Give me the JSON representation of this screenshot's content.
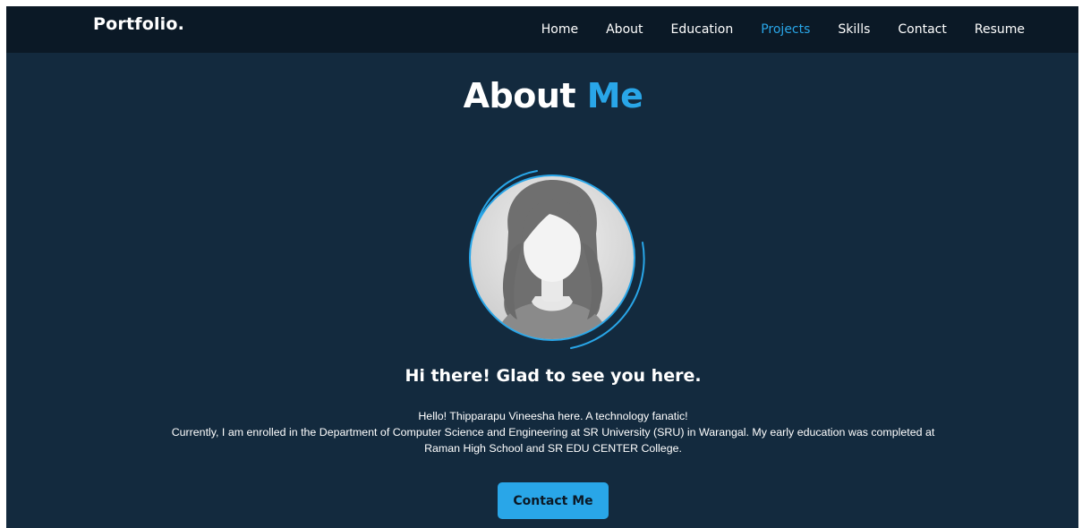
{
  "nav": {
    "brand": "Portfolio.",
    "links": [
      "Home",
      "About",
      "Education",
      "Projects",
      "Skills",
      "Contact",
      "Resume"
    ],
    "active": "Projects"
  },
  "about": {
    "title_part1": "About",
    "title_part2": "Me",
    "greeting": "Hi there! Glad to see you here.",
    "line1": "Hello! Thipparapu Vineesha here. A technology fanatic!",
    "line2": "Currently, I am enrolled in the Department of Computer Science and Engineering at SR University (SRU) in Warangal. My early education was completed at",
    "line3": "Raman High School and SR EDU CENTER College.",
    "contact_button": "Contact Me"
  },
  "colors": {
    "background": "#132a3e",
    "navbar": "#0b1926",
    "accent": "#29a6e8",
    "text": "#ffffff"
  },
  "icons": {
    "avatar": "female-avatar-placeholder"
  }
}
